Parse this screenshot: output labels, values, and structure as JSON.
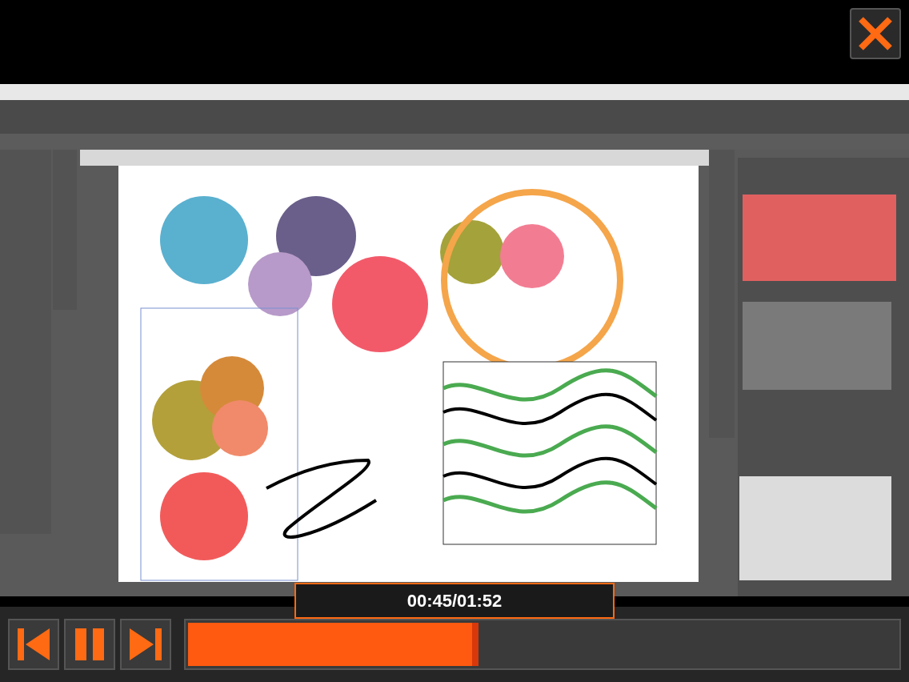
{
  "player": {
    "time": "00:45/01:52",
    "progress": {
      "level": 0.41
    },
    "controls": [
      {
        "kind": "previous"
      },
      {
        "kind": "pause"
      },
      {
        "kind": "next"
      }
    ]
  }
}
